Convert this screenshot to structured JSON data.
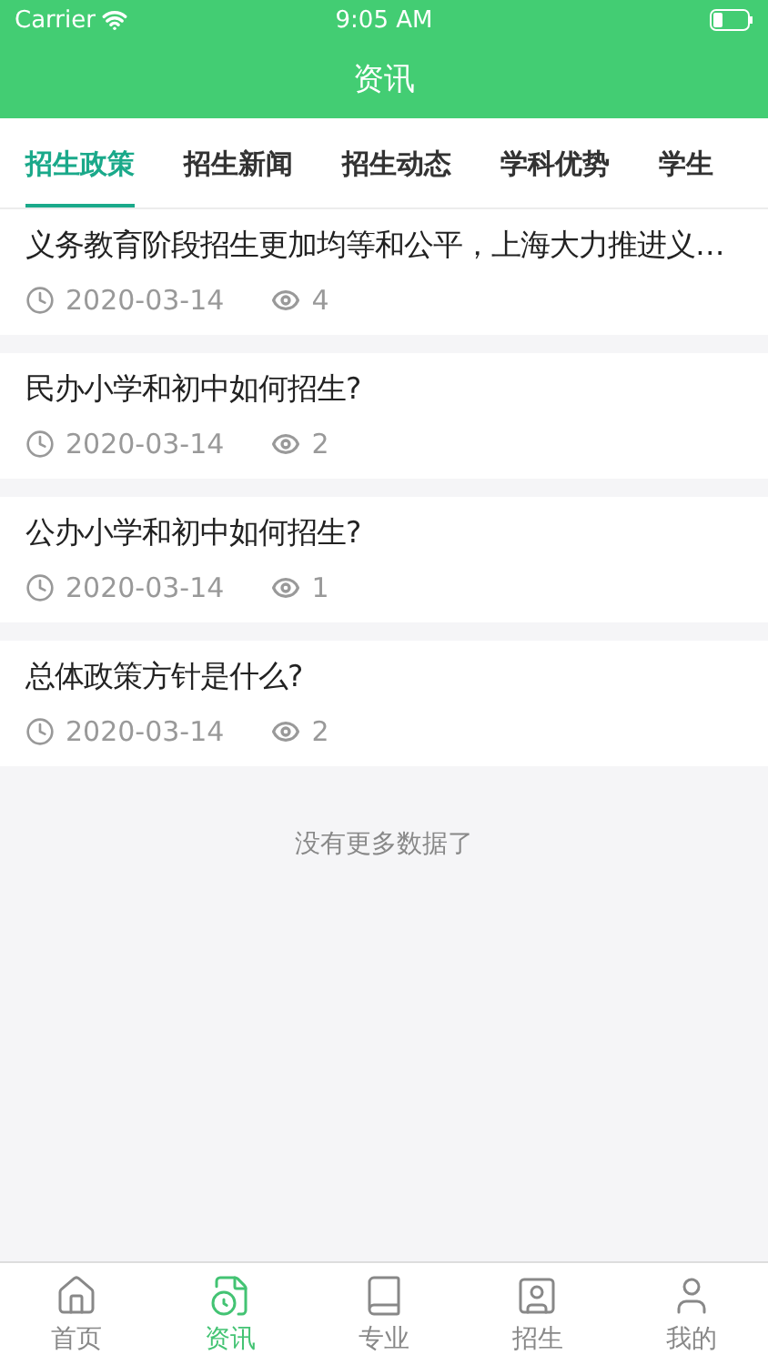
{
  "status_bar": {
    "carrier": "Carrier",
    "time": "9:05 AM"
  },
  "nav_bar": {
    "title": "资讯"
  },
  "tabs": [
    {
      "label": "招生政策",
      "selected": true
    },
    {
      "label": "招生新闻",
      "selected": false
    },
    {
      "label": "招生动态",
      "selected": false
    },
    {
      "label": "学科优势",
      "selected": false
    },
    {
      "label": "学生",
      "selected": false
    }
  ],
  "articles": [
    {
      "title": "义务教育阶段招生更加均等和公平，上海大力推进义…",
      "date": "2020-03-14",
      "views": "4"
    },
    {
      "title": "民办小学和初中如何招生?",
      "date": "2020-03-14",
      "views": "2"
    },
    {
      "title": "公办小学和初中如何招生?",
      "date": "2020-03-14",
      "views": "1"
    },
    {
      "title": "总体政策方针是什么?",
      "date": "2020-03-14",
      "views": "2"
    }
  ],
  "end_message": "没有更多数据了",
  "tab_bar": [
    {
      "kind": "home",
      "label": "首页",
      "selected": false
    },
    {
      "kind": "news",
      "label": "资讯",
      "selected": true
    },
    {
      "kind": "major",
      "label": "专业",
      "selected": false
    },
    {
      "kind": "admission",
      "label": "招生",
      "selected": false
    },
    {
      "kind": "profile",
      "label": "我的",
      "selected": false
    }
  ]
}
